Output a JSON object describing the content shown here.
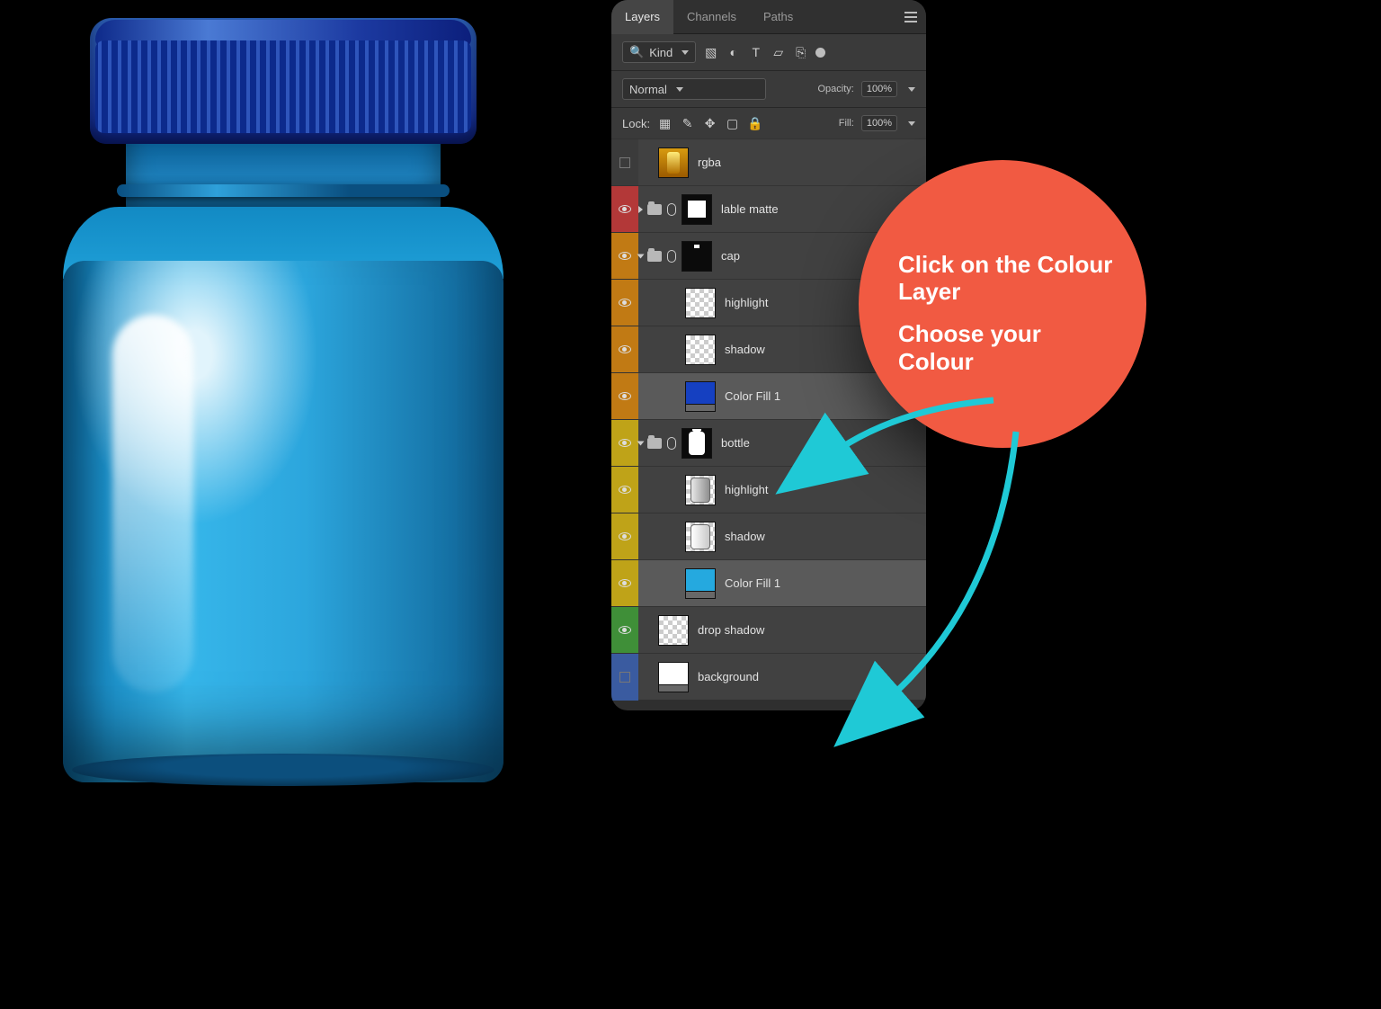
{
  "tabs": {
    "layers": "Layers",
    "channels": "Channels",
    "paths": "Paths"
  },
  "filter": {
    "kind": "Kind"
  },
  "blend": {
    "mode": "Normal",
    "opacity_label": "Opacity:",
    "opacity": "100%"
  },
  "lock": {
    "label": "Lock:",
    "fill_label": "Fill:",
    "fill": "100%"
  },
  "layers": {
    "rgba": "rgba",
    "label_matte": "lable matte",
    "cap": "cap",
    "cap_highlight": "highlight",
    "cap_shadow": "shadow",
    "cap_colorfill": "Color Fill 1",
    "bottle": "bottle",
    "bottle_highlight": "highlight",
    "bottle_shadow": "shadow",
    "bottle_colorfill": "Color Fill 1",
    "drop_shadow": "drop shadow",
    "background": "background"
  },
  "callout": {
    "line1": "Click on the Colour Layer",
    "line2": "Choose your Colour"
  },
  "colors": {
    "cap_fill": "#1540c1",
    "bottle_fill": "#25a9df",
    "bubble": "#f15a42",
    "arrow": "#1fc9d6"
  }
}
